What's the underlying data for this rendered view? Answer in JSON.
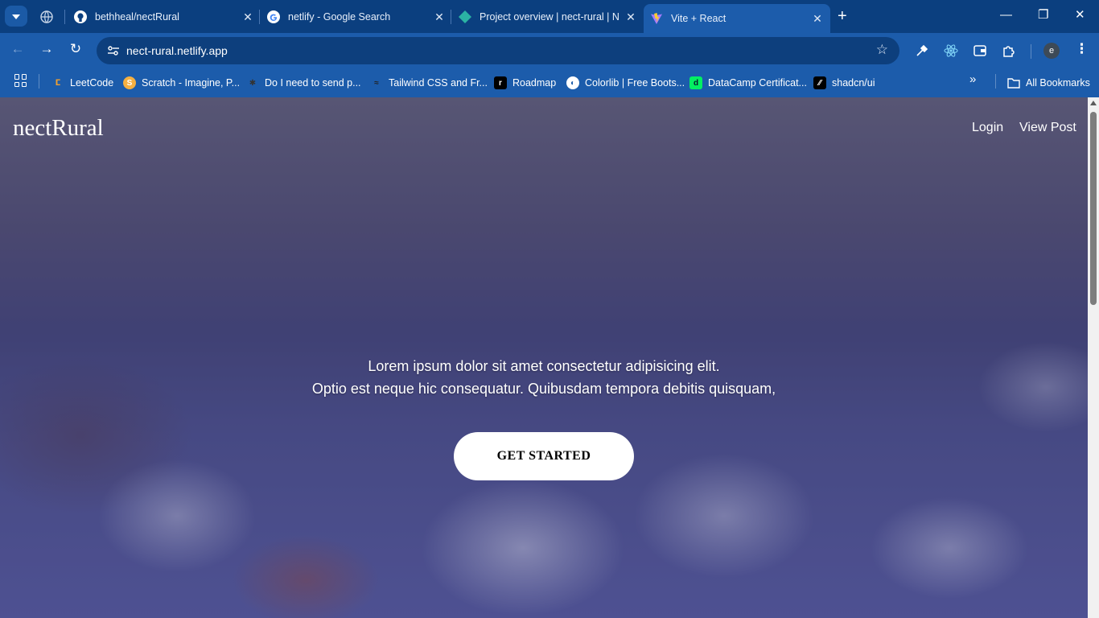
{
  "browser": {
    "tabs": [
      {
        "title": "",
        "favicon": "globe-icon",
        "pinned": true
      },
      {
        "title": "bethheal/nectRural",
        "favicon": "github-icon"
      },
      {
        "title": "netlify - Google Search",
        "favicon": "google-icon"
      },
      {
        "title": "Project overview | nect-rural | N",
        "favicon": "netlify-icon"
      },
      {
        "title": "Vite + React",
        "favicon": "vite-icon",
        "active": true
      }
    ],
    "url": "nect-rural.netlify.app",
    "profile_initial": "e",
    "bookmarks": [
      {
        "label": "LeetCode",
        "icon": "leetcode-icon",
        "color": "#f0a030"
      },
      {
        "label": "Scratch - Imagine, P...",
        "icon": "scratch-icon",
        "color": "#f5b041"
      },
      {
        "label": "Do I need to send p...",
        "icon": "bug-icon",
        "color": "#333333"
      },
      {
        "label": "Tailwind CSS and Fr...",
        "icon": "tailwind-icon",
        "color": "#222222"
      },
      {
        "label": "Roadmap",
        "icon": "roadmap-icon",
        "color": "#000000"
      },
      {
        "label": "Colorlib | Free Boots...",
        "icon": "colorlib-icon",
        "color": "#ffffff"
      },
      {
        "label": "DataCamp Certificat...",
        "icon": "datacamp-icon",
        "color": "#03ef62"
      },
      {
        "label": "shadcn/ui",
        "icon": "shadcn-icon",
        "color": "#000000"
      }
    ],
    "all_bookmarks_label": "All Bookmarks"
  },
  "site": {
    "logo": "nectRural",
    "nav": {
      "login": "Login",
      "view_post": "View Post"
    },
    "hero": {
      "line1": "Lorem ipsum dolor sit amet consectetur adipisicing elit.",
      "line2": "Optio est neque hic consequatur. Quibusdam tempora debitis quisquam,"
    },
    "cta_label": "GET STARTED"
  },
  "colors": {
    "chrome_dark": "#0b3f7f",
    "chrome": "#1c5cab",
    "cta_bg": "#ffffff"
  }
}
